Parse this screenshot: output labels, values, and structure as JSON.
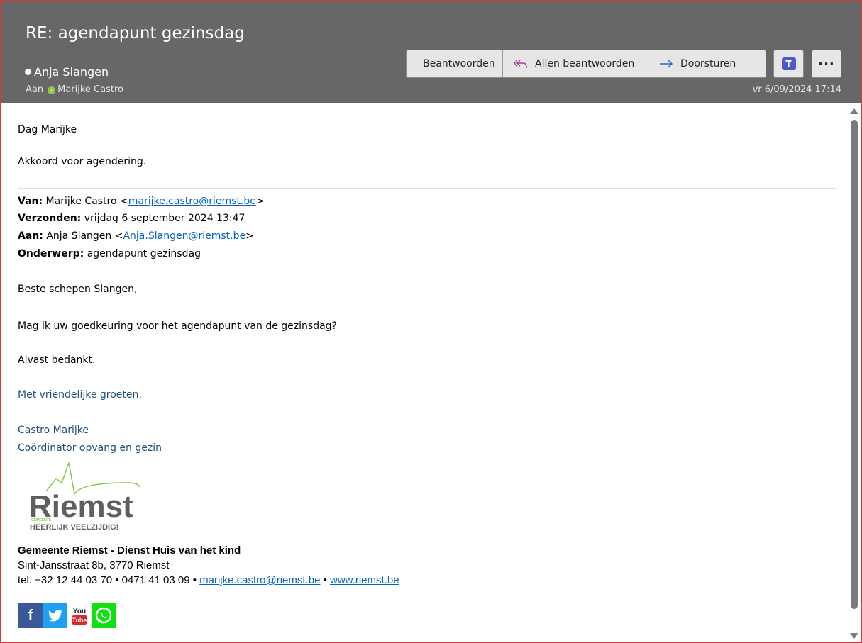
{
  "header": {
    "subject": "RE: agendapunt gezinsdag",
    "sender": "Anja Slangen",
    "to_label": "Aan",
    "recipient": "Marijke Castro",
    "date": "vr 6/09/2024 17:14"
  },
  "actions": {
    "reply": "Beantwoorden",
    "reply_all": "Allen beantwoorden",
    "forward": "Doorsturen",
    "teams_icon": "teams-icon",
    "more_icon": "more-icon"
  },
  "body": {
    "greeting": "Dag Marijke",
    "reply_text": "Akkoord voor agendering.",
    "quoted": {
      "from_label": "Van:",
      "from_name": "Marijke Castro <",
      "from_email": "marijke.castro@riemst.be",
      "sent_label": "Verzonden:",
      "sent_value": "vrijdag 6 september 2024 13:47",
      "to_label": "Aan:",
      "to_name": "Anja Slangen <",
      "to_email": "Anja.Slangen@riemst.be",
      "subject_label": "Onderwerp:",
      "subject_value": "agendapunt gezinsdag",
      "close_bracket": ">"
    },
    "salutation": "Beste schepen Slangen,",
    "question": "Mag ik uw goedkeuring voor het agendapunt van de gezinsdag?",
    "thanks": "Alvast bedankt.",
    "closing": "Met vriendelijke groeten,",
    "signature_name": "Castro Marijke",
    "signature_role": "Coördinator opvang en gezin"
  },
  "logo": {
    "brand": "Riemst",
    "small": "GEMEENTE",
    "tagline": "HEERLIJK VEELZIJDIG!"
  },
  "signature": {
    "org": "Gemeente Riemst - Dienst Huis van het kind",
    "address": "Sint-Jansstraat 8b, 3770 Riemst",
    "tel": "tel. +32 12 44 03 70 • 0471 41 03 09 • ",
    "email": "marijke.castro@riemst.be",
    "sep": " • ",
    "website": "www.riemst.be"
  },
  "socials": {
    "facebook": "f",
    "youtube_top": "You",
    "youtube_bottom": "Tube"
  },
  "colors": {
    "header_bg": "#676767",
    "link": "#0563c1",
    "signature_blue": "#1f4e79",
    "logo_green": "#8dc63f",
    "logo_grey": "#5f5f5f"
  }
}
